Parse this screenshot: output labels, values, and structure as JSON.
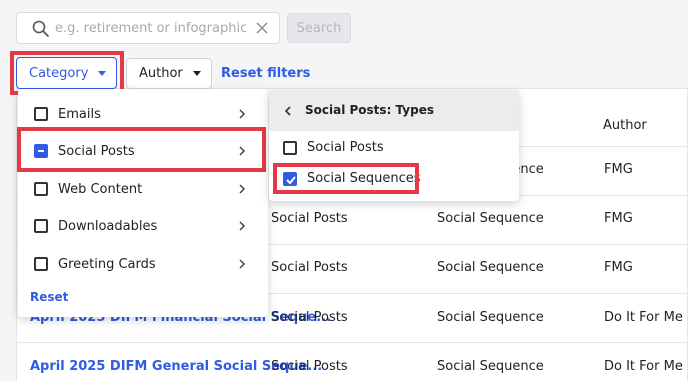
{
  "search": {
    "placeholder": "e.g. retirement or infographic",
    "value": "",
    "button_label": "Search"
  },
  "filters": {
    "category_label": "Category",
    "author_label": "Author",
    "reset_label": "Reset filters"
  },
  "table": {
    "header_author": "Author",
    "rows": [
      {
        "title": "",
        "type": "",
        "subtype": "Social Sequence",
        "author": "FMG"
      },
      {
        "title": "",
        "type": "Social Posts",
        "subtype": "Social Sequence",
        "author": "FMG"
      },
      {
        "title": "",
        "type": "Social Posts",
        "subtype": "Social Sequence",
        "author": "FMG"
      },
      {
        "title": "April 2025 DIFM Financial Social Seque...",
        "type": "Social Posts",
        "subtype": "Social Sequence",
        "author": "Do It For Me"
      },
      {
        "title": "April 2025 DIFM General Social Seque...",
        "type": "Social Posts",
        "subtype": "Social Sequence",
        "author": "Do It For Me"
      }
    ]
  },
  "category_menu": {
    "items": [
      {
        "label": "Emails",
        "state": "unchecked"
      },
      {
        "label": "Social Posts",
        "state": "indeterminate"
      },
      {
        "label": "Web Content",
        "state": "unchecked"
      },
      {
        "label": "Downloadables",
        "state": "unchecked"
      },
      {
        "label": "Greeting Cards",
        "state": "unchecked"
      }
    ],
    "reset_label": "Reset"
  },
  "submenu": {
    "title": "Social Posts: Types",
    "items": [
      {
        "label": "Social Posts",
        "checked": false
      },
      {
        "label": "Social Sequences",
        "checked": true
      }
    ]
  },
  "colors": {
    "accent": "#2f5be5",
    "highlight": "#e63946"
  }
}
